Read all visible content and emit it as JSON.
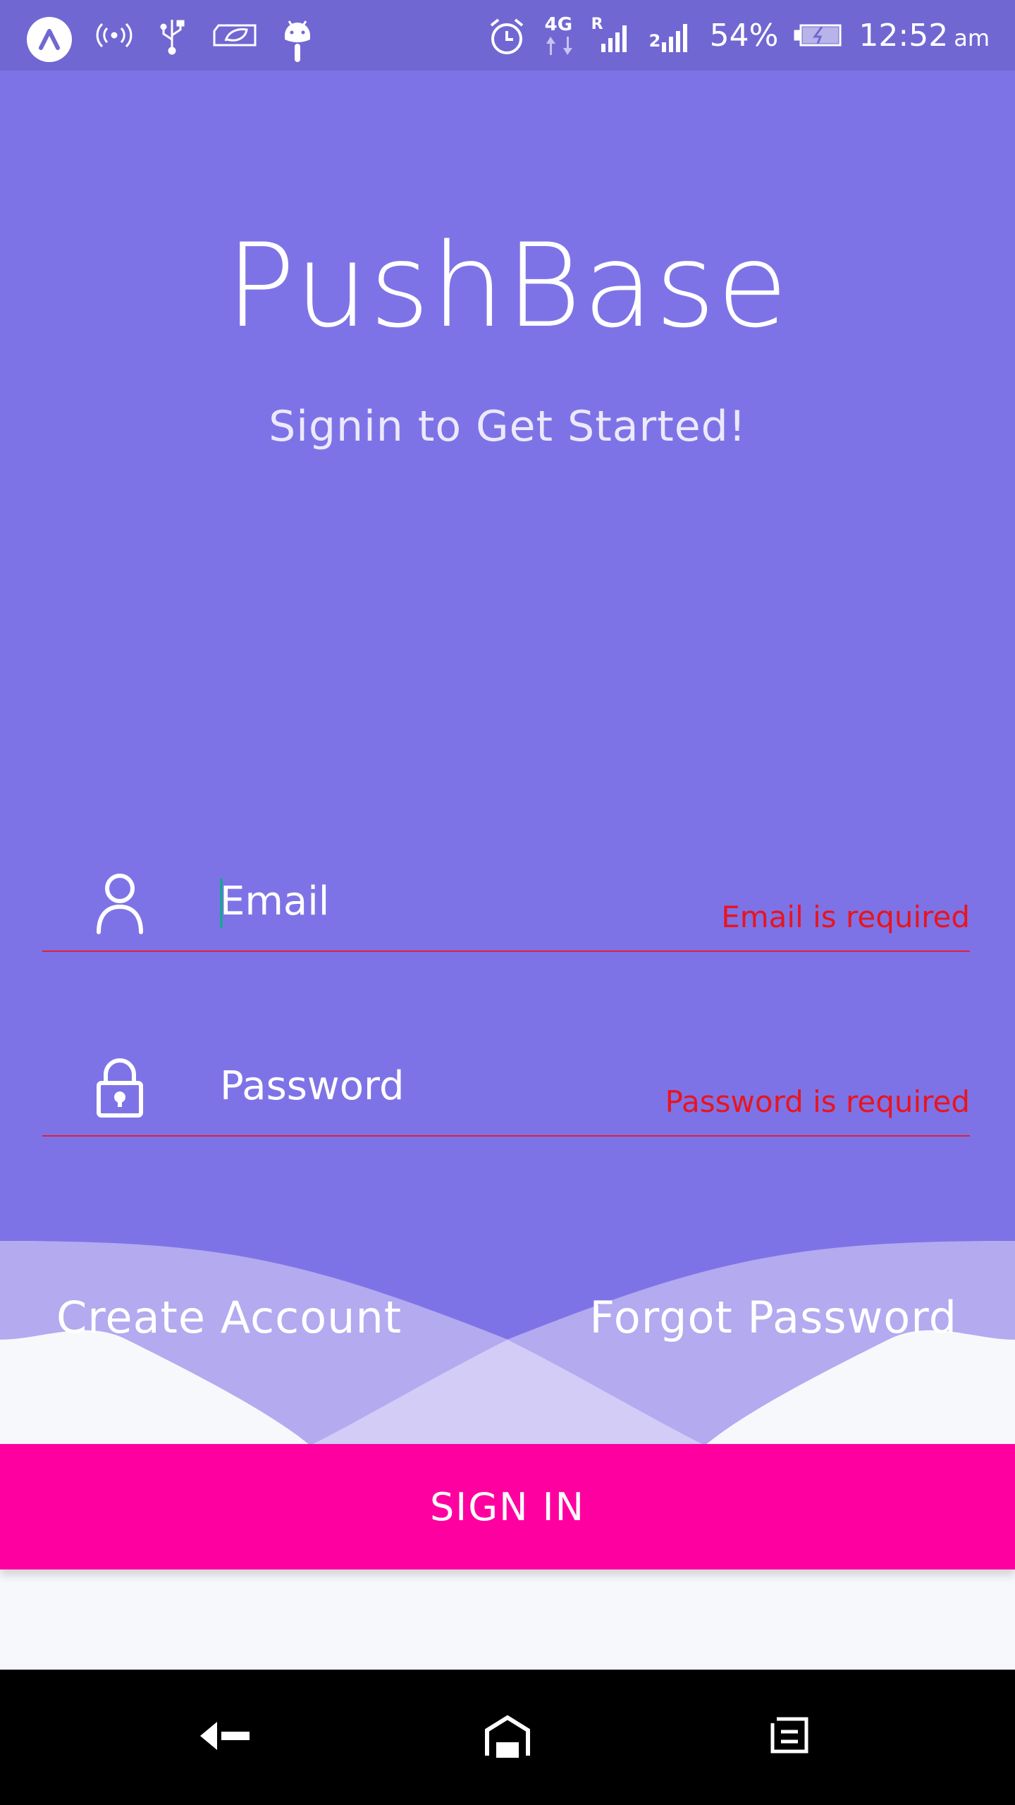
{
  "status_bar": {
    "network_label": "4G",
    "roaming_label": "R",
    "sim2_label": "2",
    "battery": "54%",
    "time": "12:52",
    "ampm": "am",
    "icons": [
      "app-icon",
      "hotspot-icon",
      "usb-icon",
      "battery-saver-icon",
      "android-icon",
      "alarm-icon",
      "network-icon",
      "signal-icon",
      "signal-2-icon",
      "battery-charging-icon"
    ]
  },
  "app": {
    "title": "PushBase",
    "subtitle": "Signin to Get Started!"
  },
  "form": {
    "email": {
      "placeholder": "Email",
      "value": "",
      "error": "Email is required",
      "icon": "user-icon"
    },
    "password": {
      "placeholder": "Password",
      "value": "",
      "error": "Password is required",
      "icon": "lock-icon"
    }
  },
  "links": {
    "create_account": "Create Account",
    "forgot_password": "Forgot Password"
  },
  "sign_in_label": "SIGN IN",
  "nav_bar": {
    "icons": [
      "back-icon",
      "home-icon",
      "recent-apps-icon"
    ]
  },
  "colors": {
    "status_bar": "#7167d2",
    "primary": "#7e73e6",
    "accent": "#ff00a0",
    "error": "#e8141f",
    "background": "#f7f8fc"
  }
}
